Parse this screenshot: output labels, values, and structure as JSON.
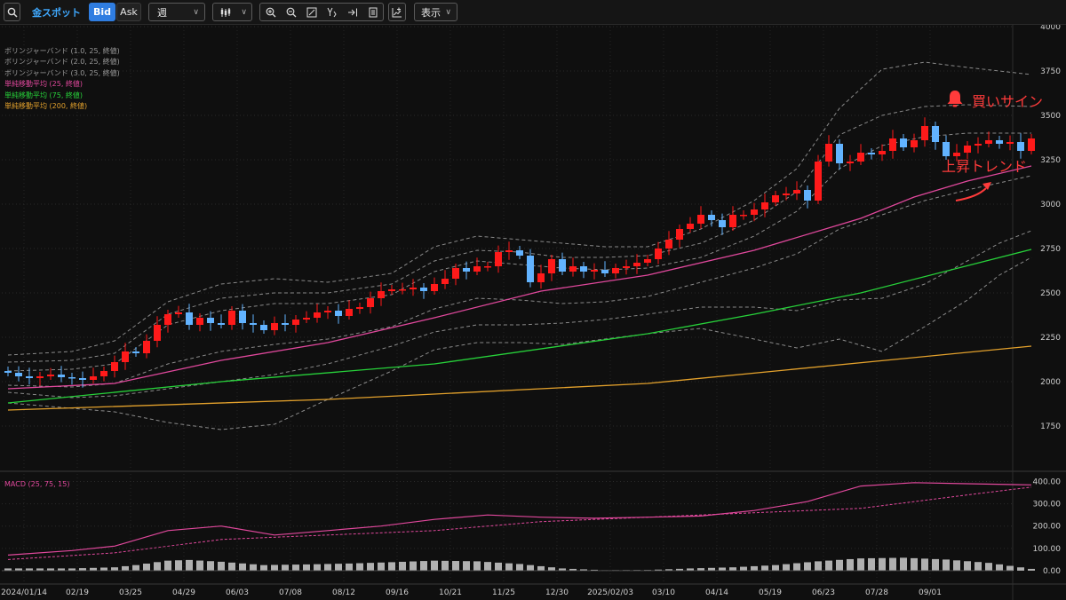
{
  "toolbar": {
    "symbol": "金スポット",
    "bid_label": "Bid",
    "ask_label": "Ask",
    "period": "週",
    "display_label": "表示",
    "icons": [
      "search-icon",
      "candlestick-type-icon",
      "zoom-in-icon",
      "zoom-out-icon",
      "fit-screen-icon",
      "auto-scale-icon",
      "jump-to-latest-icon",
      "document-icon",
      "add-indicator-icon"
    ]
  },
  "legend": [
    {
      "label": "ボリンジャーバンド (1.0, 25, 終値)",
      "color": "#9a9a9a"
    },
    {
      "label": "ボリンジャーバンド (2.0, 25, 終値)",
      "color": "#9a9a9a"
    },
    {
      "label": "ボリンジャーバンド (3.0, 25, 終値)",
      "color": "#9a9a9a"
    },
    {
      "label": "単純移動平均 (25, 終値)",
      "color": "#e0489c"
    },
    {
      "label": "単純移動平均 (75, 終値)",
      "color": "#27d13a"
    },
    {
      "label": "単純移動平均 (200, 終値)",
      "color": "#e3a12c"
    }
  ],
  "annotations": {
    "buy_signal": "買いサイン",
    "uptrend": "上昇トレンド",
    "color": "#ff3b3b"
  },
  "colors": {
    "up": "#ff1a1a",
    "down": "#62b3ff",
    "sma25": "#e0489c",
    "sma75": "#27d13a",
    "sma200": "#e3a12c",
    "bands": "#8a8a8a",
    "macd_line": "#e0489c",
    "hist": "#b0b0b0"
  },
  "chart_data": {
    "type": "candlestick",
    "title": "",
    "xlabel": "",
    "ylabel": "",
    "x_ticks": [
      "2024/01/14",
      "02/19",
      "03/25",
      "04/29",
      "06/03",
      "07/08",
      "08/12",
      "09/16",
      "10/21",
      "11/25",
      "12/30",
      "2025/02/03",
      "03/10",
      "04/14",
      "05/19",
      "06/23",
      "07/28",
      "09/01"
    ],
    "price_ticks": [
      1750,
      2000,
      2250,
      2500,
      2750,
      3000,
      3250,
      3500,
      3750,
      4000
    ],
    "ylim": [
      1500,
      4000
    ],
    "closes": [
      2050,
      2030,
      2020,
      2030,
      2040,
      2025,
      2020,
      2010,
      2030,
      2060,
      2110,
      2170,
      2160,
      2230,
      2320,
      2380,
      2390,
      2320,
      2360,
      2330,
      2320,
      2400,
      2330,
      2320,
      2290,
      2330,
      2320,
      2350,
      2360,
      2390,
      2400,
      2370,
      2410,
      2420,
      2470,
      2510,
      2520,
      2520,
      2530,
      2510,
      2550,
      2580,
      2640,
      2620,
      2650,
      2650,
      2730,
      2740,
      2710,
      2560,
      2610,
      2690,
      2620,
      2650,
      2620,
      2630,
      2610,
      2640,
      2650,
      2670,
      2690,
      2750,
      2800,
      2860,
      2890,
      2940,
      2910,
      2870,
      2940,
      2940,
      2970,
      3010,
      3050,
      3060,
      3080,
      3020,
      3240,
      3340,
      3230,
      3240,
      3290,
      3280,
      3300,
      3370,
      3320,
      3360,
      3440,
      3350,
      3270,
      3290,
      3330,
      3340,
      3360,
      3340,
      3350,
      3300,
      3370
    ],
    "opens": [
      2060,
      2050,
      2030,
      2020,
      2030,
      2040,
      2025,
      2020,
      2010,
      2030,
      2060,
      2110,
      2170,
      2160,
      2230,
      2320,
      2380,
      2390,
      2320,
      2360,
      2330,
      2320,
      2400,
      2330,
      2320,
      2290,
      2330,
      2320,
      2350,
      2360,
      2390,
      2400,
      2370,
      2410,
      2420,
      2470,
      2510,
      2520,
      2520,
      2530,
      2510,
      2550,
      2580,
      2640,
      2620,
      2650,
      2650,
      2730,
      2740,
      2710,
      2560,
      2610,
      2690,
      2620,
      2650,
      2620,
      2630,
      2610,
      2640,
      2650,
      2670,
      2690,
      2750,
      2800,
      2860,
      2890,
      2940,
      2910,
      2870,
      2940,
      2940,
      2970,
      3010,
      3050,
      3060,
      3080,
      3020,
      3240,
      3340,
      3230,
      3240,
      3290,
      3280,
      3300,
      3370,
      3320,
      3360,
      3440,
      3350,
      3270,
      3290,
      3330,
      3340,
      3360,
      3340,
      3350,
      3300
    ],
    "series": [
      {
        "name": "単純移動平均 (25, 終値)",
        "x_weeks": [
          0,
          10,
          20,
          30,
          40,
          50,
          60,
          70,
          80,
          85,
          90,
          96
        ],
        "values": [
          1960,
          1990,
          2120,
          2220,
          2360,
          2510,
          2600,
          2740,
          2920,
          3040,
          3130,
          3215
        ]
      },
      {
        "name": "単純移動平均 (75, 終値)",
        "x_weeks": [
          0,
          20,
          40,
          60,
          70,
          80,
          96
        ],
        "values": [
          1880,
          2000,
          2100,
          2270,
          2380,
          2500,
          2745
        ]
      },
      {
        "name": "単純移動平均 (200, 終値)",
        "x_weeks": [
          0,
          30,
          60,
          96
        ],
        "values": [
          1840,
          1900,
          1990,
          2200
        ]
      }
    ],
    "bands": {
      "x_weeks": [
        0,
        6,
        10,
        15,
        20,
        25,
        30,
        36,
        40,
        44,
        48,
        52,
        56,
        60,
        65,
        70,
        74,
        78,
        82,
        86,
        90,
        93,
        96
      ],
      "upper3": [
        2150,
        2170,
        2230,
        2450,
        2550,
        2580,
        2560,
        2610,
        2760,
        2820,
        2800,
        2780,
        2760,
        2760,
        2860,
        3020,
        3200,
        3540,
        3760,
        3800,
        3770,
        3750,
        3730
      ],
      "upper2": [
        2110,
        2120,
        2160,
        2380,
        2470,
        2500,
        2500,
        2550,
        2680,
        2740,
        2730,
        2700,
        2700,
        2710,
        2780,
        2910,
        3070,
        3390,
        3500,
        3550,
        3560,
        3555,
        3550
      ],
      "upper1": [
        2060,
        2070,
        2100,
        2320,
        2400,
        2440,
        2440,
        2490,
        2620,
        2680,
        2660,
        2640,
        2630,
        2640,
        2700,
        2820,
        2960,
        3200,
        3330,
        3380,
        3400,
        3400,
        3400
      ],
      "lower1": [
        1980,
        1970,
        1990,
        2100,
        2170,
        2210,
        2240,
        2310,
        2410,
        2470,
        2460,
        2440,
        2450,
        2480,
        2560,
        2640,
        2720,
        2860,
        2940,
        3020,
        3080,
        3120,
        3160
      ],
      "lower2": [
        1940,
        1910,
        1920,
        1960,
        2000,
        2040,
        2100,
        2200,
        2280,
        2320,
        2320,
        2330,
        2350,
        2380,
        2420,
        2420,
        2400,
        2460,
        2470,
        2550,
        2680,
        2780,
        2850
      ],
      "lower3": [
        1880,
        1850,
        1830,
        1770,
        1730,
        1760,
        1900,
        2060,
        2180,
        2220,
        2220,
        2210,
        2240,
        2270,
        2300,
        2240,
        2190,
        2240,
        2170,
        2310,
        2460,
        2600,
        2700
      ]
    },
    "macd": {
      "label": "MACD (25, 75, 15)",
      "ticks": [
        0,
        100,
        200,
        300,
        400
      ],
      "tick_labels": [
        "0.00",
        "100.00",
        "200.00",
        "300.00",
        "400.00"
      ],
      "ylim": [
        -60,
        430
      ],
      "line_weeks": [
        0,
        6,
        10,
        15,
        20,
        25,
        30,
        35,
        40,
        45,
        50,
        55,
        60,
        65,
        70,
        75,
        80,
        85,
        90,
        96
      ],
      "line": [
        70,
        90,
        110,
        180,
        200,
        160,
        180,
        200,
        230,
        250,
        240,
        235,
        240,
        245,
        270,
        310,
        380,
        395,
        390,
        385
      ],
      "signal_weeks": [
        0,
        10,
        20,
        30,
        40,
        50,
        60,
        70,
        80,
        90,
        96
      ],
      "signal": [
        50,
        80,
        140,
        160,
        180,
        220,
        240,
        260,
        280,
        340,
        375
      ],
      "hist_weeks": [
        0,
        6,
        10,
        12,
        15,
        17,
        20,
        24,
        28,
        32,
        36,
        40,
        44,
        48,
        52,
        56,
        60,
        64,
        68,
        72,
        76,
        80,
        84,
        88,
        92,
        96
      ],
      "hist": [
        10,
        10,
        15,
        25,
        45,
        48,
        40,
        25,
        28,
        32,
        38,
        45,
        42,
        30,
        10,
        2,
        3,
        10,
        15,
        25,
        42,
        55,
        58,
        50,
        35,
        8
      ]
    }
  }
}
